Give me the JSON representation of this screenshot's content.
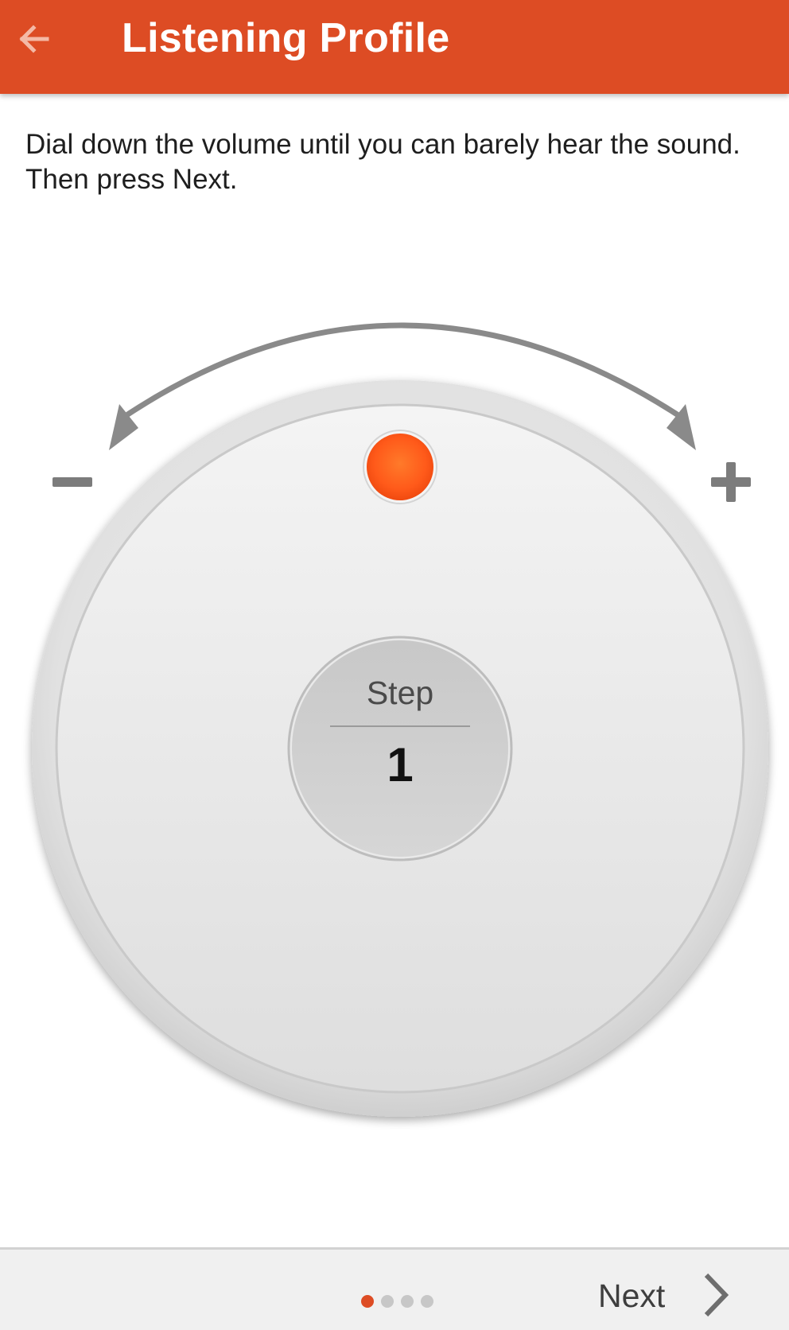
{
  "header": {
    "title": "Listening Profile",
    "back_icon": "arrow-left-icon",
    "background_color": "#dd4c24"
  },
  "instruction": "Dial down the volume until you can barely hear the sound. Then press Next.",
  "dial": {
    "minus_icon": "minus-icon",
    "plus_icon": "plus-icon",
    "indicator_color": "#ff5a1a",
    "step_label": "Step",
    "step_value": "1"
  },
  "footer": {
    "pager": {
      "total": 4,
      "active_index": 0,
      "active_color": "#dd4c24"
    },
    "next_label": "Next",
    "next_icon": "chevron-right-icon"
  }
}
